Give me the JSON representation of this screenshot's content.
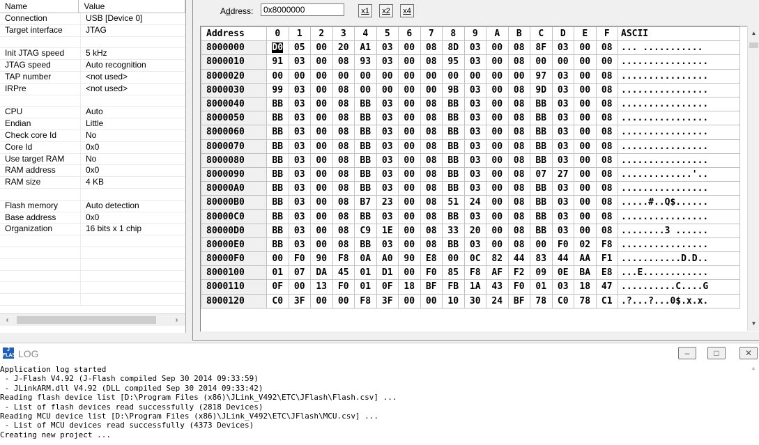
{
  "props": {
    "header": {
      "name": "Name",
      "value": "Value"
    },
    "rows": [
      {
        "name": "Connection",
        "value": "USB [Device 0]"
      },
      {
        "name": "Target interface",
        "value": "JTAG"
      },
      {
        "name": "",
        "value": ""
      },
      {
        "name": "Init JTAG speed",
        "value": "5 kHz"
      },
      {
        "name": "JTAG speed",
        "value": "Auto recognition"
      },
      {
        "name": "TAP number",
        "value": "<not used>"
      },
      {
        "name": "IRPre",
        "value": "<not used>"
      },
      {
        "name": "",
        "value": ""
      },
      {
        "name": "CPU",
        "value": "Auto"
      },
      {
        "name": "Endian",
        "value": "Little"
      },
      {
        "name": "Check core Id",
        "value": "No"
      },
      {
        "name": "Core Id",
        "value": "0x0"
      },
      {
        "name": "Use target RAM",
        "value": "No"
      },
      {
        "name": "RAM address",
        "value": "0x0"
      },
      {
        "name": "RAM size",
        "value": "4 KB"
      },
      {
        "name": "",
        "value": ""
      },
      {
        "name": "Flash memory",
        "value": "Auto detection"
      },
      {
        "name": "Base address",
        "value": "0x0"
      },
      {
        "name": "Organization",
        "value": "16 bits x 1 chip"
      },
      {
        "name": "",
        "value": ""
      },
      {
        "name": "",
        "value": ""
      },
      {
        "name": "",
        "value": ""
      },
      {
        "name": "",
        "value": ""
      },
      {
        "name": "",
        "value": ""
      },
      {
        "name": "",
        "value": ""
      }
    ]
  },
  "memory": {
    "address_label_prefix": "A",
    "address_label_underlined": "d",
    "address_label_suffix": "dress:",
    "address_value": "0x8000000",
    "zoom": [
      "x1",
      "x2",
      "x4"
    ],
    "columns": {
      "address": "Address",
      "bytes": [
        "0",
        "1",
        "2",
        "3",
        "4",
        "5",
        "6",
        "7",
        "8",
        "9",
        "A",
        "B",
        "C",
        "D",
        "E",
        "F"
      ],
      "ascii": "ASCII"
    },
    "rows": [
      {
        "addr": "8000000",
        "bytes": [
          "D0",
          "05",
          "00",
          "20",
          "A1",
          "03",
          "00",
          "08",
          "8D",
          "03",
          "00",
          "08",
          "8F",
          "03",
          "00",
          "08"
        ],
        "ascii": "...  ..........."
      },
      {
        "addr": "8000010",
        "bytes": [
          "91",
          "03",
          "00",
          "08",
          "93",
          "03",
          "00",
          "08",
          "95",
          "03",
          "00",
          "08",
          "00",
          "00",
          "00",
          "00"
        ],
        "ascii": "................"
      },
      {
        "addr": "8000020",
        "bytes": [
          "00",
          "00",
          "00",
          "00",
          "00",
          "00",
          "00",
          "00",
          "00",
          "00",
          "00",
          "00",
          "97",
          "03",
          "00",
          "08"
        ],
        "ascii": "................"
      },
      {
        "addr": "8000030",
        "bytes": [
          "99",
          "03",
          "00",
          "08",
          "00",
          "00",
          "00",
          "00",
          "9B",
          "03",
          "00",
          "08",
          "9D",
          "03",
          "00",
          "08"
        ],
        "ascii": "................"
      },
      {
        "addr": "8000040",
        "bytes": [
          "BB",
          "03",
          "00",
          "08",
          "BB",
          "03",
          "00",
          "08",
          "BB",
          "03",
          "00",
          "08",
          "BB",
          "03",
          "00",
          "08"
        ],
        "ascii": "................"
      },
      {
        "addr": "8000050",
        "bytes": [
          "BB",
          "03",
          "00",
          "08",
          "BB",
          "03",
          "00",
          "08",
          "BB",
          "03",
          "00",
          "08",
          "BB",
          "03",
          "00",
          "08"
        ],
        "ascii": "................"
      },
      {
        "addr": "8000060",
        "bytes": [
          "BB",
          "03",
          "00",
          "08",
          "BB",
          "03",
          "00",
          "08",
          "BB",
          "03",
          "00",
          "08",
          "BB",
          "03",
          "00",
          "08"
        ],
        "ascii": "................"
      },
      {
        "addr": "8000070",
        "bytes": [
          "BB",
          "03",
          "00",
          "08",
          "BB",
          "03",
          "00",
          "08",
          "BB",
          "03",
          "00",
          "08",
          "BB",
          "03",
          "00",
          "08"
        ],
        "ascii": "................"
      },
      {
        "addr": "8000080",
        "bytes": [
          "BB",
          "03",
          "00",
          "08",
          "BB",
          "03",
          "00",
          "08",
          "BB",
          "03",
          "00",
          "08",
          "BB",
          "03",
          "00",
          "08"
        ],
        "ascii": "................"
      },
      {
        "addr": "8000090",
        "bytes": [
          "BB",
          "03",
          "00",
          "08",
          "BB",
          "03",
          "00",
          "08",
          "BB",
          "03",
          "00",
          "08",
          "07",
          "27",
          "00",
          "08"
        ],
        "ascii": ".............'.."
      },
      {
        "addr": "80000A0",
        "bytes": [
          "BB",
          "03",
          "00",
          "08",
          "BB",
          "03",
          "00",
          "08",
          "BB",
          "03",
          "00",
          "08",
          "BB",
          "03",
          "00",
          "08"
        ],
        "ascii": "................"
      },
      {
        "addr": "80000B0",
        "bytes": [
          "BB",
          "03",
          "00",
          "08",
          "B7",
          "23",
          "00",
          "08",
          "51",
          "24",
          "00",
          "08",
          "BB",
          "03",
          "00",
          "08"
        ],
        "ascii": ".....#..Q$......"
      },
      {
        "addr": "80000C0",
        "bytes": [
          "BB",
          "03",
          "00",
          "08",
          "BB",
          "03",
          "00",
          "08",
          "BB",
          "03",
          "00",
          "08",
          "BB",
          "03",
          "00",
          "08"
        ],
        "ascii": "................"
      },
      {
        "addr": "80000D0",
        "bytes": [
          "BB",
          "03",
          "00",
          "08",
          "C9",
          "1E",
          "00",
          "08",
          "33",
          "20",
          "00",
          "08",
          "BB",
          "03",
          "00",
          "08"
        ],
        "ascii": "........3 ......"
      },
      {
        "addr": "80000E0",
        "bytes": [
          "BB",
          "03",
          "00",
          "08",
          "BB",
          "03",
          "00",
          "08",
          "BB",
          "03",
          "00",
          "08",
          "00",
          "F0",
          "02",
          "F8"
        ],
        "ascii": "................"
      },
      {
        "addr": "80000F0",
        "bytes": [
          "00",
          "F0",
          "90",
          "F8",
          "0A",
          "A0",
          "90",
          "E8",
          "00",
          "0C",
          "82",
          "44",
          "83",
          "44",
          "AA",
          "F1"
        ],
        "ascii": "...........D.D.."
      },
      {
        "addr": "8000100",
        "bytes": [
          "01",
          "07",
          "DA",
          "45",
          "01",
          "D1",
          "00",
          "F0",
          "85",
          "F8",
          "AF",
          "F2",
          "09",
          "0E",
          "BA",
          "E8"
        ],
        "ascii": "...E............"
      },
      {
        "addr": "8000110",
        "bytes": [
          "0F",
          "00",
          "13",
          "F0",
          "01",
          "0F",
          "18",
          "BF",
          "FB",
          "1A",
          "43",
          "F0",
          "01",
          "03",
          "18",
          "47"
        ],
        "ascii": "..........C....G"
      },
      {
        "addr": "8000120",
        "bytes": [
          "C0",
          "3F",
          "00",
          "00",
          "F8",
          "3F",
          "00",
          "00",
          "10",
          "30",
          "24",
          "BF",
          "78",
          "C0",
          "78",
          "C1"
        ],
        "ascii": ".?...?...0$.x.x."
      }
    ]
  },
  "log": {
    "title": "LOG",
    "lines": [
      "Application log started",
      " - J-Flash V4.92 (J-Flash compiled Sep 30 2014 09:33:59)",
      " - JLinkARM.dll V4.92 (DLL compiled Sep 30 2014 09:33:42)",
      "Reading flash device list [D:\\Program Files (x86)\\JLink_V492\\ETC\\JFlash\\Flash.csv] ...",
      " - List of flash devices read successfully (2818 Devices)",
      "Reading MCU device list [D:\\Program Files (x86)\\JLink_V492\\ETC\\JFlash\\MCU.csv] ...",
      " - List of MCU devices read successfully (4373 Devices)",
      "Creating new project ..."
    ]
  }
}
